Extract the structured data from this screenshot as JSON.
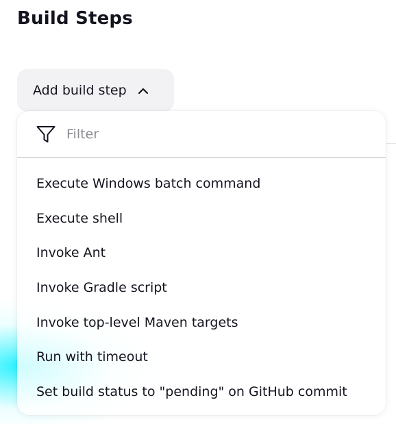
{
  "section": {
    "title": "Build Steps"
  },
  "add_step_button": {
    "label": "Add build step",
    "icon": "chevron-up-icon"
  },
  "dropdown": {
    "filter": {
      "icon": "filter-icon",
      "placeholder": "Filter",
      "value": ""
    },
    "items": [
      {
        "label": "Execute Windows batch command"
      },
      {
        "label": "Execute shell"
      },
      {
        "label": "Invoke Ant"
      },
      {
        "label": "Invoke Gradle script"
      },
      {
        "label": "Invoke top-level Maven targets"
      },
      {
        "label": "Run with timeout"
      },
      {
        "label": "Set build status to \"pending\" on GitHub commit"
      }
    ]
  },
  "colors": {
    "text": "#14141f",
    "button_bg": "#f2f2f5",
    "placeholder": "#8a8a92",
    "divider": "#bdbdc4",
    "highlight_glow": "#00f0ff"
  }
}
